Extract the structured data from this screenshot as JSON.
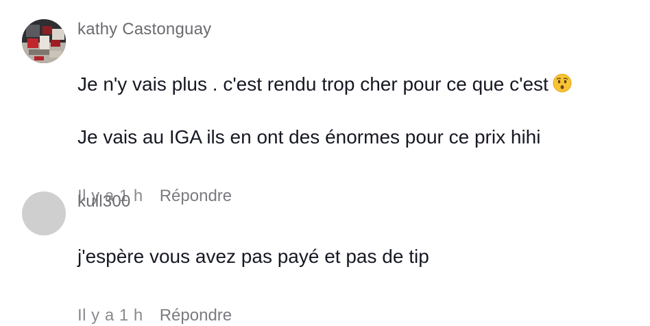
{
  "comments": [
    {
      "username": "kathy Castonguay",
      "avatar": "photo-avatar",
      "text_lines": [
        "Je n'y vais plus . c'est rendu trop cher pour ce que c'est",
        "Je vais au IGA ils en ont des énormes pour ce prix hihi"
      ],
      "emoji": "hushed-face-emoji",
      "time": "Il y a 1 h",
      "reply_label": "Répondre"
    },
    {
      "username": "kull300",
      "avatar": "default-gray-avatar",
      "text_lines": [
        "j'espère vous avez pas payé et pas de tip"
      ],
      "time": "Il y a 1 h",
      "reply_label": "Répondre"
    }
  ],
  "colors": {
    "username": "#6b6b70",
    "text": "#161823",
    "meta": "#8a8a8e",
    "avatar_default": "#cfcfcf"
  }
}
